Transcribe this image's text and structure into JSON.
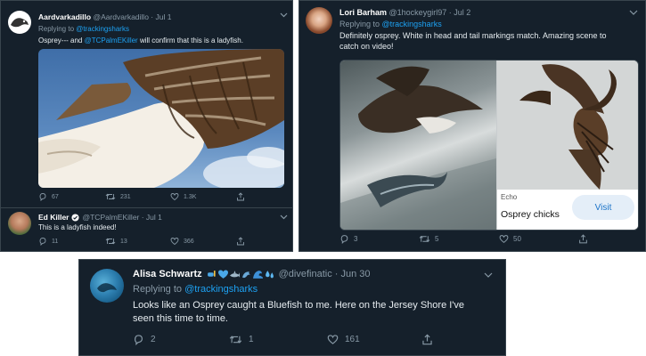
{
  "tweet1": {
    "name": "Aardvarkadillo",
    "handle": "@Aardvarkadillo · Jul 1",
    "replying_prefix": "Replying to ",
    "replying_to": "@trackingsharks",
    "text_a": "Osprey--- and ",
    "text_mention": "@TCPalmEKiller",
    "text_b": " will confirm that this is a ladyfish.",
    "replies": "67",
    "retweets": "231",
    "likes": "1.3K"
  },
  "tweet2": {
    "name": "Ed Killer",
    "handle": "@TCPalmEKiller · Jul 1",
    "text": "This is a ladyfish indeed!",
    "replies": "11",
    "retweets": "13",
    "likes": "366"
  },
  "tweet3": {
    "name": "Lori Barham",
    "handle": "@1hockeygirl97 · Jul 2",
    "replying_prefix": "Replying to ",
    "replying_to": "@trackingsharks",
    "text_line1": "Definitely osprey. White in head and tail markings match.  Amazing scene to",
    "text_line2": "catch on video!",
    "ad_label": "Echo",
    "ad_title": "Osprey chicks",
    "visit_label": "Visit",
    "replies": "3",
    "retweets": "5",
    "likes": "50"
  },
  "tweet4": {
    "name": "Alisa Schwartz",
    "handle": "@divefinatic · Jun 30",
    "replying_prefix": "Replying to ",
    "replying_to": "@trackingsharks",
    "text_line1": "Looks like an Osprey caught a Bluefish to me. Here on the Jersey Shore I've",
    "text_line2": "seen this time to time.",
    "replies": "2",
    "retweets": "1",
    "likes": "161"
  },
  "colors": {
    "background": "#15202b",
    "border": "#38444d",
    "accent": "#1da1f2",
    "muted": "#8899a6"
  },
  "icons": [
    "reply-icon",
    "retweet-icon",
    "like-icon",
    "share-icon",
    "chevron-down-icon",
    "verified-icon"
  ]
}
